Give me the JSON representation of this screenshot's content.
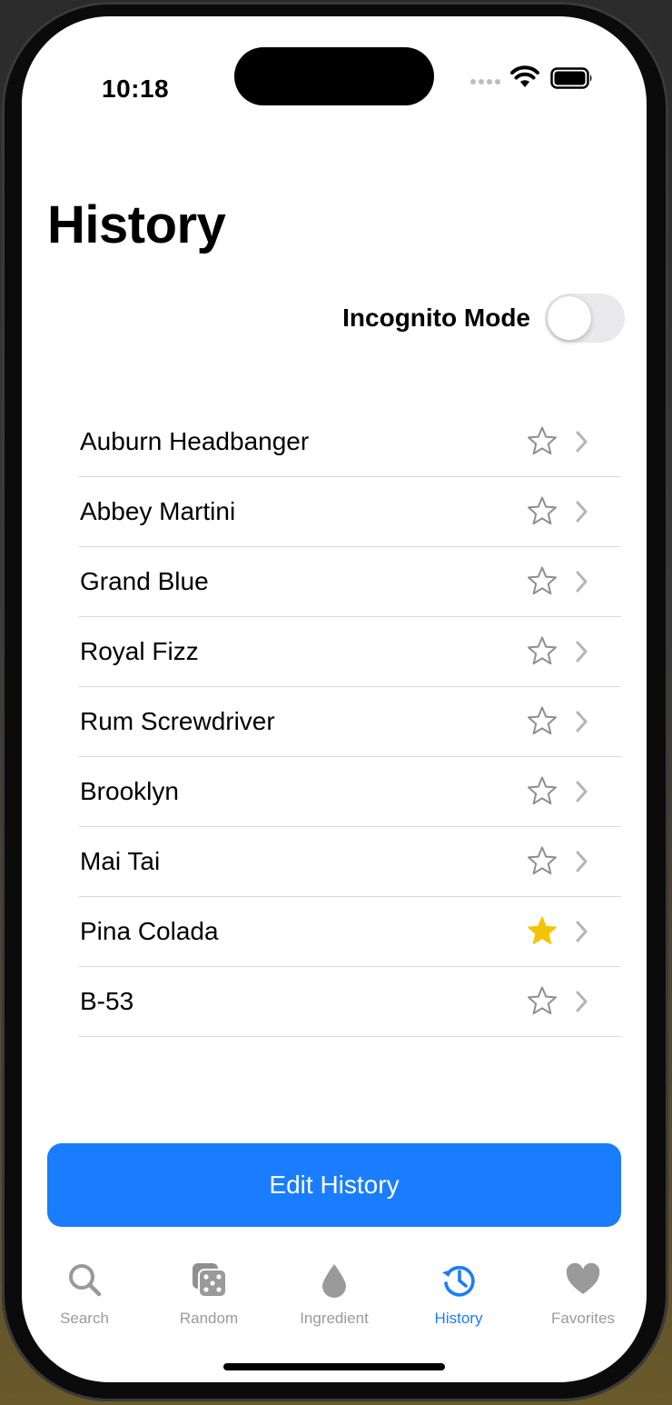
{
  "status_bar": {
    "time": "10:18"
  },
  "page": {
    "title": "History"
  },
  "incognito": {
    "label": "Incognito Mode",
    "enabled": false
  },
  "history": {
    "items": [
      {
        "name": "Auburn Headbanger",
        "favorite": false
      },
      {
        "name": "Abbey Martini",
        "favorite": false
      },
      {
        "name": "Grand Blue",
        "favorite": false
      },
      {
        "name": "Royal Fizz",
        "favorite": false
      },
      {
        "name": "Rum Screwdriver",
        "favorite": false
      },
      {
        "name": "Brooklyn",
        "favorite": false
      },
      {
        "name": "Mai Tai",
        "favorite": false
      },
      {
        "name": "Pina Colada",
        "favorite": true
      },
      {
        "name": "B-53",
        "favorite": false
      }
    ]
  },
  "actions": {
    "edit_label": "Edit History"
  },
  "tabbar": {
    "tabs": [
      {
        "label": "Search",
        "icon": "search-icon"
      },
      {
        "label": "Random",
        "icon": "dice-icon"
      },
      {
        "label": "Ingredient",
        "icon": "drop-icon"
      },
      {
        "label": "History",
        "icon": "history-icon",
        "active": true
      },
      {
        "label": "Favorites",
        "icon": "heart-icon"
      }
    ]
  },
  "colors": {
    "accent": "#1a7cff",
    "favorite": "#f5c400",
    "inactive": "#9a9a9a"
  }
}
